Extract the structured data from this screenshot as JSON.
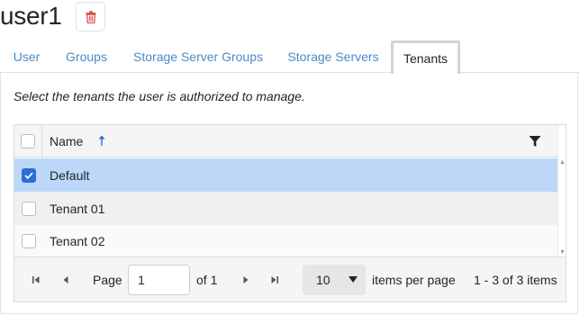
{
  "title": "user1",
  "tabs": [
    {
      "label": "User",
      "active": false
    },
    {
      "label": "Groups",
      "active": false
    },
    {
      "label": "Storage Server Groups",
      "active": false
    },
    {
      "label": "Storage Servers",
      "active": false
    },
    {
      "label": "Tenants",
      "active": true
    }
  ],
  "hint": "Select the tenants the user is authorized to manage.",
  "grid": {
    "column_name": "Name",
    "sort": "ascending",
    "rows": [
      {
        "name": "Default",
        "checked": true
      },
      {
        "name": "Tenant 01",
        "checked": false
      },
      {
        "name": "Tenant 02",
        "checked": false
      }
    ]
  },
  "pager": {
    "page_label": "Page",
    "page_value": "1",
    "of_label": "of 1",
    "per_page_value": "10",
    "per_page_label": "items per page",
    "summary": "1 - 3 of 3 items"
  },
  "colors": {
    "link": "#4a8bc9",
    "selected_row": "#bcd7f8",
    "checkbox_checked": "#2a6fd6",
    "delete_icon": "#d9534f"
  },
  "icons": {
    "delete": "trash-icon",
    "sort": "arrow-up-icon",
    "filter": "filter-icon",
    "first": "first-page-icon",
    "prev": "previous-page-icon",
    "next": "next-page-icon",
    "last": "last-page-icon"
  }
}
